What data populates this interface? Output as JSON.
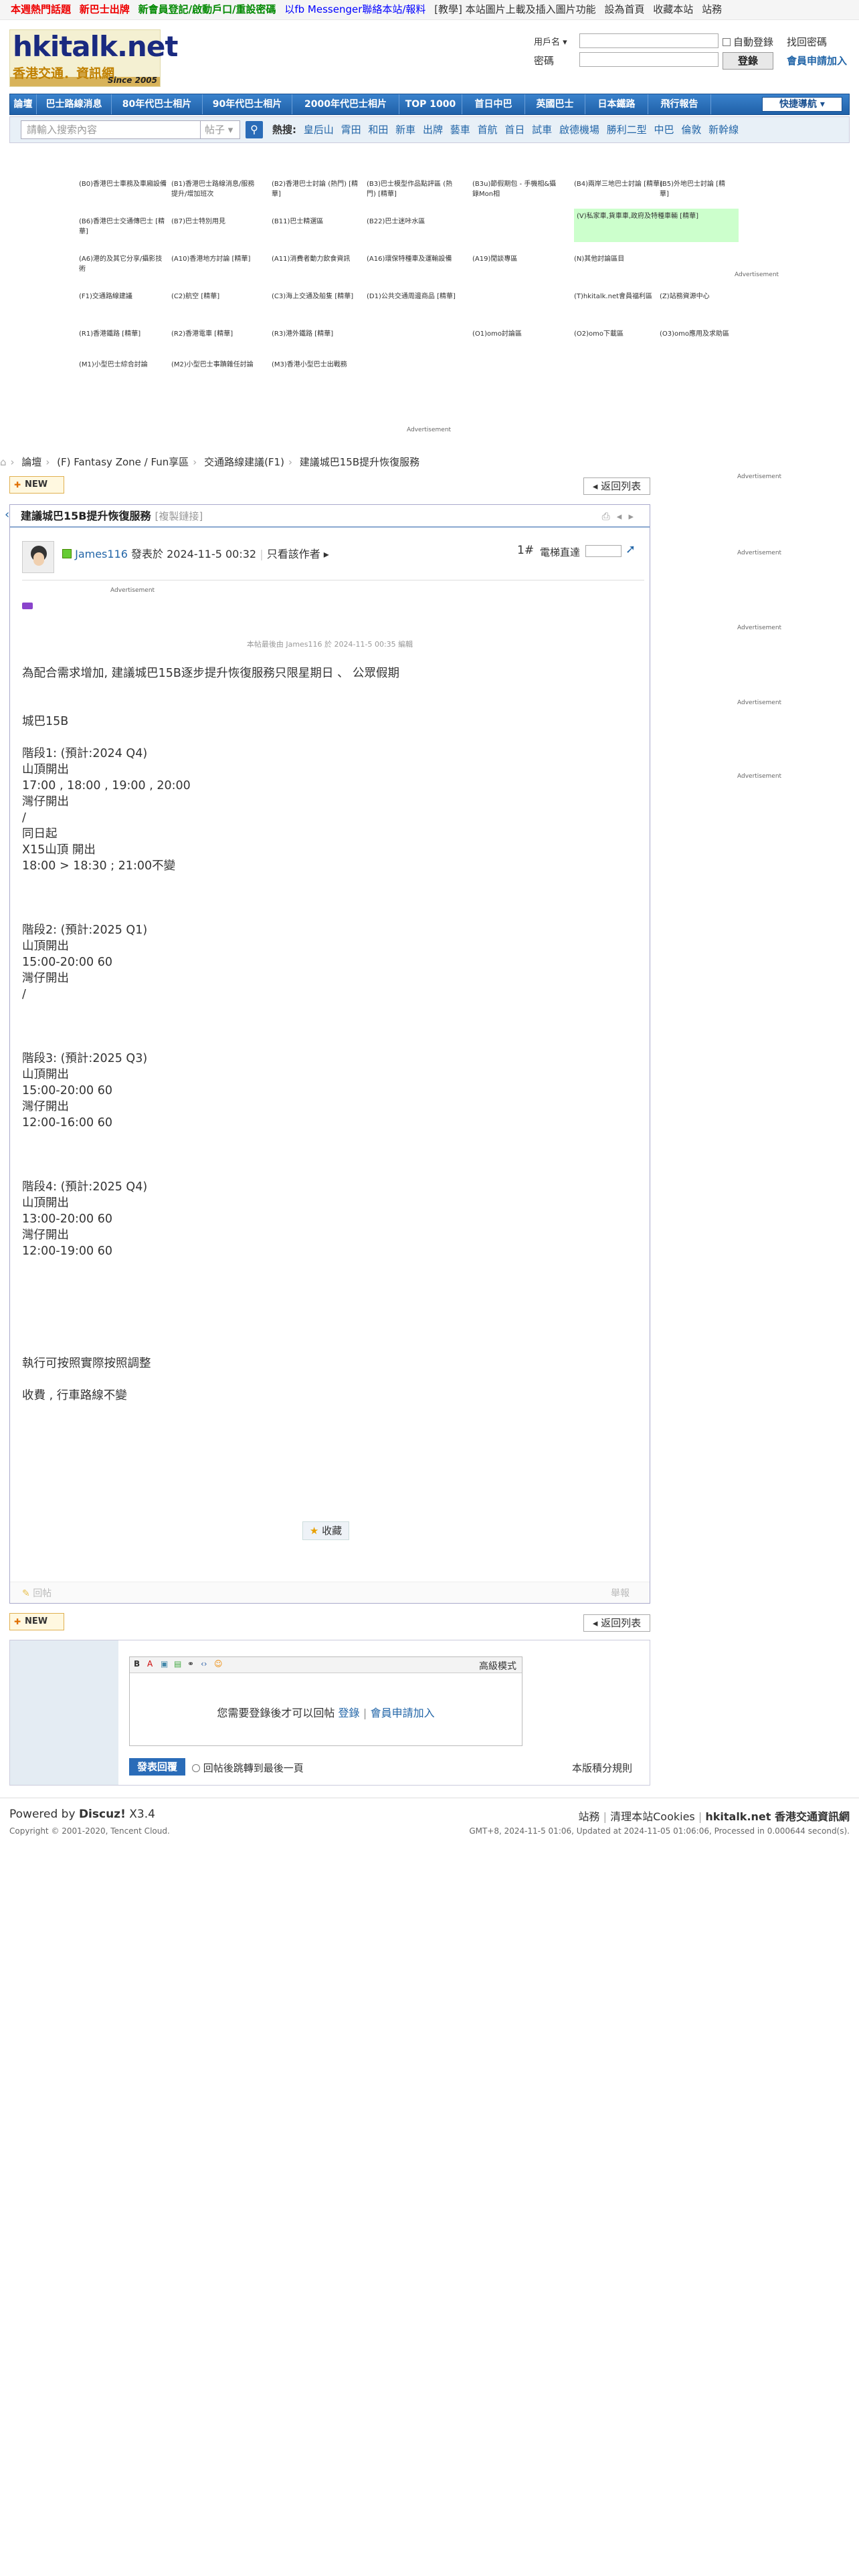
{
  "topbar": {
    "items": [
      {
        "text": "本週熱門話題",
        "style": "red"
      },
      {
        "text": "新巴士出牌",
        "style": "red"
      },
      {
        "text": "新會員登記/啟動戶口/重設密碼",
        "style": "green"
      },
      {
        "text": "以fb Messenger聯絡本站/報料",
        "style": "blue"
      },
      {
        "text": "[教學] 本站圖片上載及插入圖片功能",
        "style": "plain"
      },
      {
        "text": "設為首頁",
        "style": "plain"
      },
      {
        "text": "收藏本站",
        "style": "plain"
      },
      {
        "text": "站務",
        "style": "plain"
      }
    ]
  },
  "logo": {
    "line1": "hkitalk.net",
    "line2": "香港交通．資訊網",
    "line3": "Since 2005"
  },
  "login": {
    "username_label": "用戶名",
    "password_label": "密碼",
    "auto_login": "自動登錄",
    "forgot": "找回密碼",
    "login_button": "登錄",
    "register": "會員申請加入"
  },
  "nav": {
    "items": [
      "論壇",
      "巴士路線消息",
      "80年代巴士相片",
      "90年代巴士相片",
      "2000年代巴士相片",
      "TOP 1000",
      "首日中巴",
      "英國巴士",
      "日本鐵路",
      "飛行報告"
    ],
    "quicknav": "快捷導航"
  },
  "search": {
    "placeholder": "請輸入搜索內容",
    "scope": "帖子",
    "hot_label": "熱搜:",
    "hot_terms": [
      "皇后山",
      "霄田",
      "和田",
      "新車",
      "出牌",
      "藝車",
      "首航",
      "首日",
      "試車",
      "啟德機場",
      "勝利二型",
      "中巴",
      "倫敦",
      "新幹線"
    ]
  },
  "forums": {
    "rows": [
      [
        "(B0)香港巴士車務及車廂設備",
        "(B1)香港巴士路線消息/服務提升/增加班次",
        "(B2)香港巴士討論 (熱門) [精華]",
        "(B3)巴士模型作品點評區 (熱門) [精華]",
        "(B3u)節假期包 - 手機相&攝錄Mon相",
        "(B4)兩岸三地巴士討論 [精華]",
        "(B5)外地巴士討論 [精華]"
      ],
      [
        "(B6)香港巴士交通傳巴士 [精華]",
        "(B7)巴士特別用見",
        "(B11)巴士精選區",
        "(B22)巴士迷咔水區",
        "",
        "(V)私家車,貨車車,政府及特種車輛 [精華]",
        ""
      ],
      [
        "(A6)港的及其它分享/攝影技術",
        "(A10)香港地方討論 [精華]",
        "(A11)消費者動力飲食資訊",
        "(A16)環保特種車及運輸設備",
        "(A19)閒談專區",
        "(N)其他討論區目",
        ""
      ],
      [
        "(F1)交通路線建議",
        "(C2)航空 [精華]",
        "(C3)海上交通及船隻 [精華]",
        "(D1)公共交通周邊商品 [精華]",
        "",
        "(T)hkitalk.net會員福利區",
        "(Z)站務資源中心"
      ],
      [
        "(R1)香港鐵路 [精華]",
        "(R2)香港電車 [精華]",
        "(R3)港外鐵路 [精華]",
        "",
        "(O1)omo討論區",
        "(O2)omo下載區",
        "(O3)omo應用及求助區"
      ],
      [
        "(M1)小型巴士綜合討論",
        "(M2)小型巴士事蹟雜任討論",
        "(M3)香港小型巴士出戰務",
        "",
        "",
        "",
        ""
      ]
    ]
  },
  "ads": {
    "label": "Advertisement"
  },
  "breadcrumb": [
    "論壇",
    "(F) Fantasy Zone / Fun享區",
    "交通路線建議(F1)",
    "建議城巴15B提升恢復服務"
  ],
  "buttons": {
    "new": "NEW",
    "back": "返回列表",
    "favorite": "收藏",
    "reply": "回帖",
    "report": "舉報"
  },
  "post": {
    "title": "建議城巴15B提升恢復服務",
    "title_tag": "[複製鏈接]",
    "author": "James116",
    "posted": "發表於 2024-11-5 00:32",
    "only_author": "只看該作者",
    "floor": "1#",
    "jump_label": "電梯直達",
    "edited": "本帖最後由 James116 於 2024-11-5 00:35 編輯",
    "body": [
      "為配合需求增加, 建議城巴15B逐步提升恢復服務只限星期日 、 公眾假期",
      "",
      "",
      "城巴15B",
      "",
      "階段1: (預計:2024 Q4)",
      "山頂開出",
      "17:00 , 18:00 , 19:00 , 20:00",
      "灣仔開出",
      "/",
      "同日起",
      "X15山頂 開出",
      "18:00 > 18:30 ; 21:00不變",
      "",
      "",
      "",
      "階段2: (預計:2025 Q1)",
      "山頂開出",
      "15:00-20:00 60",
      "灣仔開出",
      "/",
      "",
      "",
      "",
      "階段3: (預計:2025 Q3)",
      "山頂開出",
      "15:00-20:00 60",
      "灣仔開出",
      "12:00-16:00 60",
      "",
      "",
      "",
      "階段4: (預計:2025 Q4)",
      "山頂開出",
      "13:00-20:00 60",
      "灣仔開出",
      "12:00-19:00 60",
      "",
      "",
      "",
      "",
      "",
      "",
      "執行可按照實際按照調整",
      "",
      "收費 , 行車路線不變"
    ]
  },
  "reply": {
    "advanced": "高級模式",
    "need_login": "您需要登錄後才可以回帖",
    "login": "登錄",
    "register": "會員申請加入",
    "publish": "發表回覆",
    "jump_last": "回帖後跳轉到最後一頁",
    "credit_rules": "本版積分規則"
  },
  "footer": {
    "powered": "Powered by",
    "brand": "Discuz!",
    "version": "X3.4",
    "copyright": "Copyright © 2001-2020, Tencent Cloud.",
    "links": [
      "站務",
      "清理本站Cookies",
      "hkitalk.net 香港交通資訊網"
    ],
    "status": "GMT+8, 2024-11-5 01:06, Updated at 2024-11-05 01:06:06, Processed in 0.000644 second(s)."
  }
}
